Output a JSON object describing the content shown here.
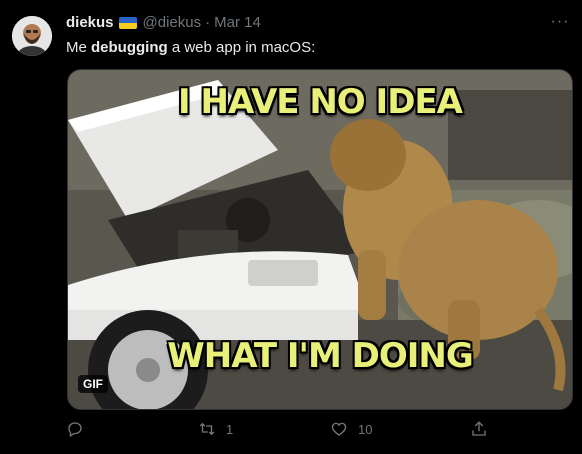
{
  "tweet": {
    "display_name": "diekus",
    "handle": "@diekus",
    "separator": "·",
    "date": "Mar 14",
    "text_before": "Me ",
    "text_bold": "debugging",
    "text_after": " a web app in macOS:",
    "more_icon": "···"
  },
  "media": {
    "caption_top": "I HAVE NO IDEA",
    "caption_bottom": "WHAT I'M DOING",
    "badge": "GIF"
  },
  "actions": {
    "reply_count": "",
    "retweet_count": "1",
    "like_count": "10"
  },
  "colors": {
    "background": "#000000",
    "text_primary": "#e7e9ea",
    "text_secondary": "#71767b",
    "caption": "#e8f07a",
    "flag_blue": "#2b64c5",
    "flag_yellow": "#f4ce1c"
  }
}
